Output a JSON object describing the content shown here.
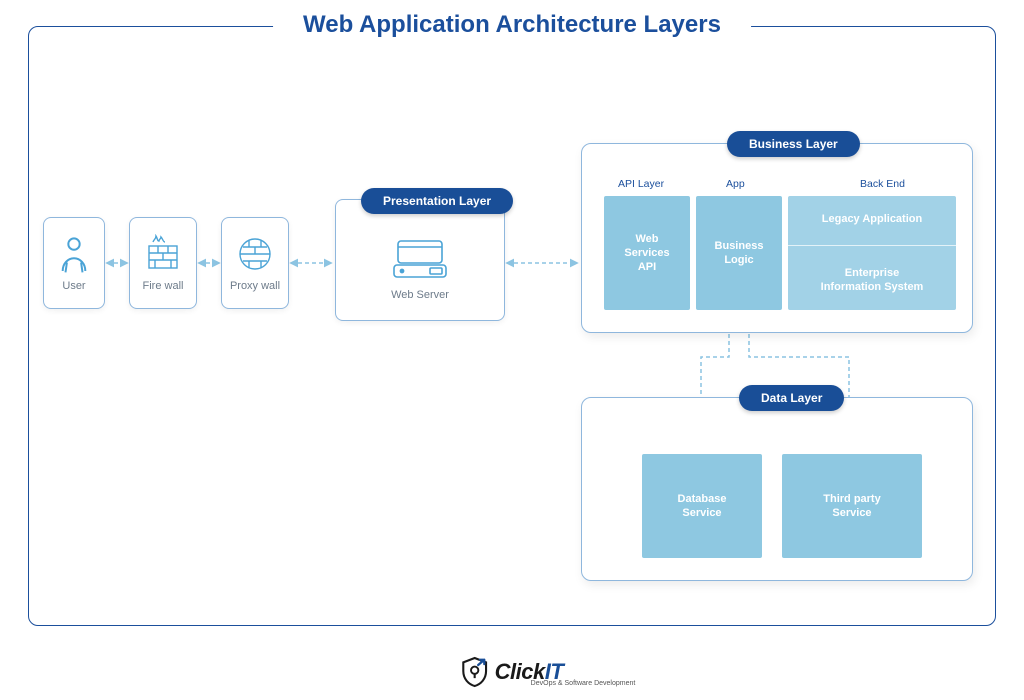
{
  "title": "Web Application Architecture Layers",
  "nodes": {
    "user": "User",
    "firewall": "Fire wall",
    "proxy": "Proxy wall",
    "webserver": "Web Server"
  },
  "layers": {
    "presentation": "Presentation Layer",
    "business": "Business Layer",
    "data": "Data Layer"
  },
  "business": {
    "col_api": "API Layer",
    "col_app": "App",
    "col_backend": "Back End",
    "web_services_api": "Web\nServices\nAPI",
    "business_logic": "Business\nLogic",
    "legacy_app": "Legacy Application",
    "eis": "Enterprise\nInformation System"
  },
  "data": {
    "db": "Database\nService",
    "third_party": "Third party\nService"
  },
  "logo": {
    "brand_left": "Click",
    "brand_right": "IT",
    "tagline": "DevOps & Software Development"
  }
}
